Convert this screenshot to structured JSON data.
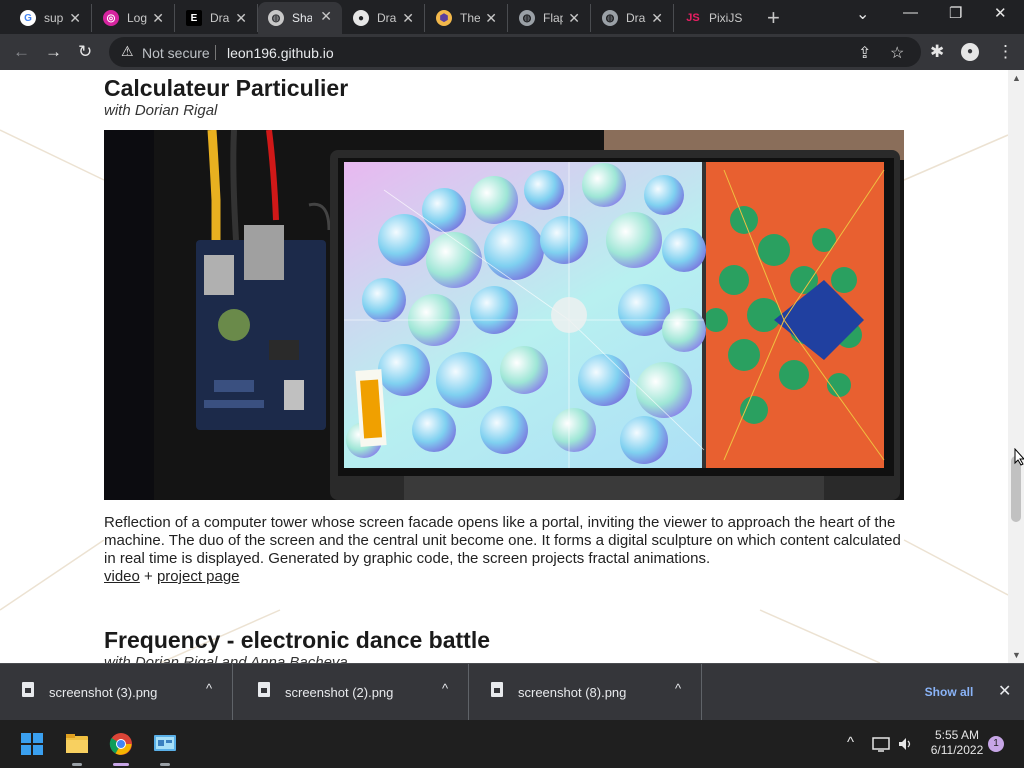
{
  "browser": {
    "tabs": [
      {
        "title": "sup",
        "favicon": "google-icon",
        "favicon_bg": "#ffffff",
        "favicon_fg": "#4285f4",
        "favicon_char": "G"
      },
      {
        "title": "Log",
        "favicon": "instagram-icon",
        "favicon_bg": "#d6249f",
        "favicon_fg": "#ffffff",
        "favicon_char": "◎"
      },
      {
        "title": "Dra",
        "favicon": "e-logo-icon",
        "favicon_bg": "#000000",
        "favicon_fg": "#ffffff",
        "favicon_char": "E"
      },
      {
        "title": "Sha",
        "favicon": "shadertoy-icon",
        "favicon_bg": "#c8c8c8",
        "favicon_fg": "#35363a",
        "favicon_char": "◍"
      },
      {
        "title": "Dra",
        "favicon": "github-icon",
        "favicon_bg": "#e6e6e6",
        "favicon_fg": "#202124",
        "favicon_char": "●"
      },
      {
        "title": "The",
        "favicon": "hexagon-icon",
        "favicon_bg": "#f2b84b",
        "favicon_fg": "#5a3e9e",
        "favicon_char": "⬢"
      },
      {
        "title": "Flap",
        "favicon": "globe-icon",
        "favicon_bg": "#9aa0a6",
        "favicon_fg": "#202124",
        "favicon_char": "◍"
      },
      {
        "title": "Dra",
        "favicon": "globe-icon",
        "favicon_bg": "#9aa0a6",
        "favicon_fg": "#202124",
        "favicon_char": "◍"
      },
      {
        "title": "PixiJS",
        "favicon": "pixijs-icon",
        "favicon_bg": "#202124",
        "favicon_fg": "#e91e63",
        "favicon_char": "JS"
      }
    ],
    "active_tab_index": 3,
    "new_tab_symbol": "+",
    "tab_close_symbol": "✕",
    "window_controls": {
      "dropdown": "⌄",
      "minimize": "—",
      "restore": "❐",
      "close": "✕"
    },
    "toolbar": {
      "back": "←",
      "forward": "→",
      "reload": "↻",
      "share": "⇪",
      "star": "☆",
      "extensions": "✱",
      "profile": "●",
      "menu": "⋮"
    },
    "security_icon": "⚠",
    "security_label": "Not secure",
    "url": "leon196.github.io"
  },
  "page": {
    "project1": {
      "title": "Calculateur Particulier",
      "subtitle": "with Dorian Rigal",
      "description": "Reflection of a computer tower whose screen facade opens like a portal, inviting the viewer to approach the heart of the machine. The duo of the screen and the central unit become one. It forms a digital sculpture on which content calculated in real time is displayed. Generated by graphic code, the screen projects fractal animations.",
      "link_video": "video",
      "link_separator": " + ",
      "link_project": "project page"
    },
    "project2": {
      "title": "Frequency - electronic dance battle",
      "subtitle": "with Dorian Rigal and Anna Bacheva"
    }
  },
  "scrollbar": {
    "up": "▲",
    "down": "▼",
    "position": 0.66
  },
  "downloads": {
    "items": [
      {
        "name": "screenshot (3).png"
      },
      {
        "name": "screenshot (2).png"
      },
      {
        "name": "screenshot (8).png"
      }
    ],
    "chevron": "^",
    "show_all": "Show all",
    "close": "✕"
  },
  "taskbar": {
    "tray_chevron": "^",
    "time": "5:55 AM",
    "date": "6/11/2022",
    "notification_count": "1"
  }
}
